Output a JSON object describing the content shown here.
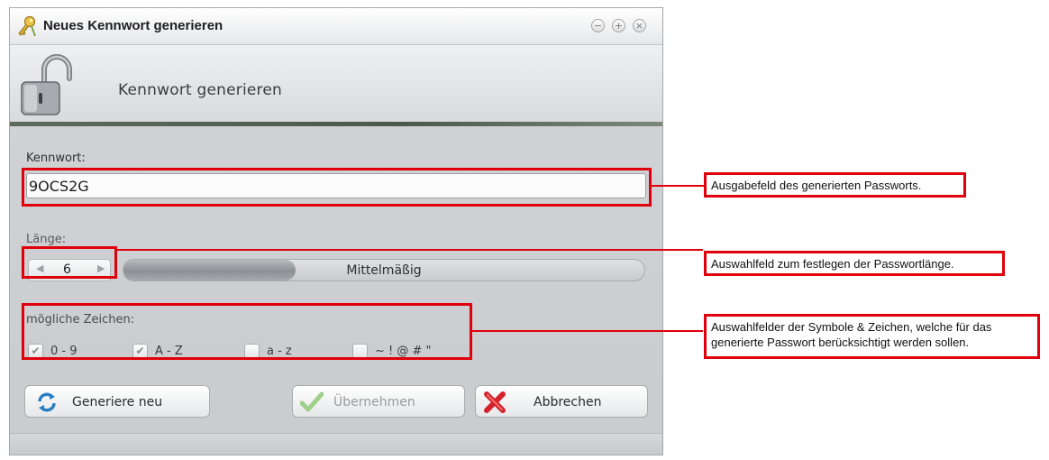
{
  "window": {
    "title": "Neues Kennwort generieren",
    "header_text": "Kennwort generieren"
  },
  "password": {
    "label": "Kennwort:",
    "value": "9OCS2G"
  },
  "length": {
    "label": "Länge:",
    "value": "6",
    "strength_label": "Mittelmäßig",
    "strength_fraction": 0.33
  },
  "chars": {
    "label": "mögliche Zeichen:",
    "options": [
      {
        "label": "0 - 9",
        "checked": true
      },
      {
        "label": "A - Z",
        "checked": true
      },
      {
        "label": "a - z",
        "checked": false
      },
      {
        "label": "~ ! @ # \"",
        "checked": false
      }
    ]
  },
  "buttons": {
    "regenerate": "Generiere neu",
    "apply": "Übernehmen",
    "cancel": "Abbrechen"
  },
  "annotations": {
    "password_field": "Ausgabefeld des generierten Passworts.",
    "length_field": "Auswahlfeld zum festlegen der Passwortlänge.",
    "charset_fields_line1": "Auswahlfelder der Symbole & Zeichen, welche für das",
    "charset_fields_line2": "generierte Passwort berücksichtigt werden sollen."
  },
  "colors": {
    "annotation_red": "#e0000b",
    "header_line": "#4a5a4a"
  }
}
